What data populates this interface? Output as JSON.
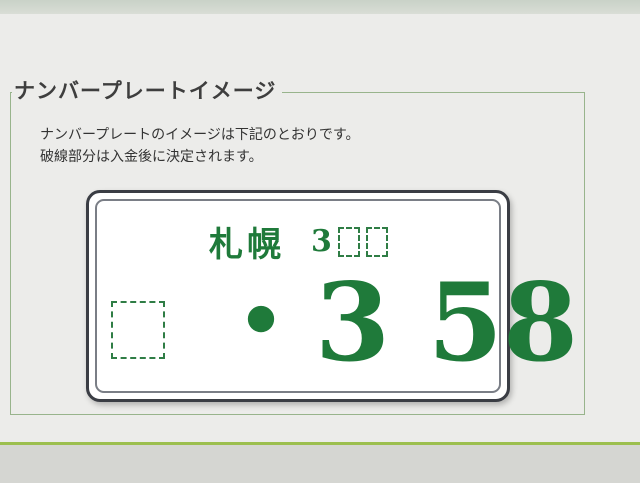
{
  "section": {
    "title": "ナンバープレートイメージ"
  },
  "description": {
    "line1": "ナンバープレートのイメージは下記のとおりです。",
    "line2": "破線部分は入金後に決定されます。"
  },
  "plate": {
    "region": "札幌",
    "class_prefix": "3",
    "number": "・3 58",
    "pending_slot_placeholder": "□"
  },
  "colors": {
    "plate_text": "#1f7a3a",
    "fieldset_border": "#98b48c",
    "accent_bar": "#9cbf4e"
  }
}
